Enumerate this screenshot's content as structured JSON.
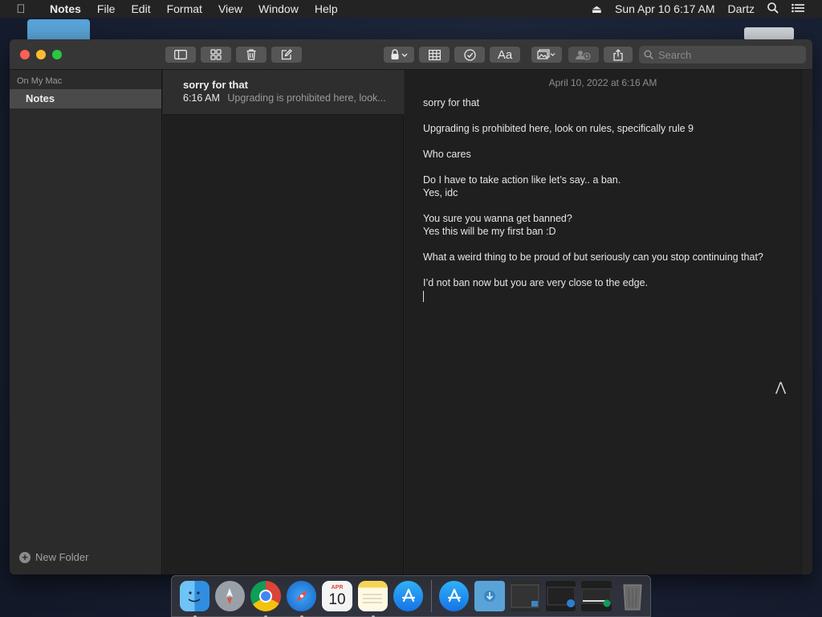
{
  "menubar": {
    "app_name": "Notes",
    "menus": [
      "File",
      "Edit",
      "Format",
      "View",
      "Window",
      "Help"
    ],
    "datetime": "Sun Apr 10  6:17 AM",
    "user": "Dartz"
  },
  "sidebar": {
    "section_label": "On My Mac",
    "folders": [
      {
        "label": "Notes"
      }
    ],
    "new_folder_label": "New Folder"
  },
  "search": {
    "placeholder": "Search"
  },
  "note_list": [
    {
      "title": "sorry for that",
      "time": "6:16 AM",
      "preview": "Upgrading is prohibited here, look..."
    }
  ],
  "editor": {
    "date": "April 10, 2022 at 6:16 AM",
    "lines": [
      "sorry for that",
      "",
      "Upgrading is prohibited here, look on rules, specifically rule 9",
      "",
      "Who cares",
      "",
      "Do I have to take action like let’s say.. a ban.",
      "Yes, idc",
      "",
      "You sure you wanna get banned?",
      "Yes this will be my first ban :D",
      "",
      "What a weird thing to be proud of but seriously can you stop continuing that?",
      "",
      "I’d not ban now but you are very close to the edge."
    ]
  },
  "dock": {
    "calendar_month": "APR",
    "calendar_day": "10"
  },
  "colors": {
    "accent_close": "#fe5f57",
    "accent_min": "#febc2e",
    "accent_max": "#28c840",
    "selected_folder": "#4a4a4a"
  }
}
